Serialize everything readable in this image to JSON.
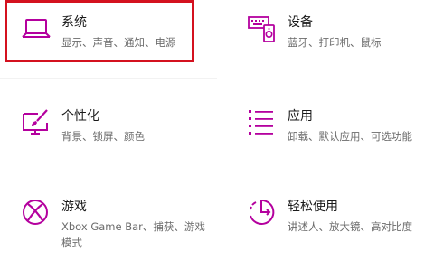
{
  "accent_color": "#b4009e",
  "focus_color": "#d4111f",
  "tiles": [
    {
      "title": "系统",
      "desc": "显示、声音、通知、电源",
      "icon": "laptop-icon"
    },
    {
      "title": "设备",
      "desc": "蓝牙、打印机、鼠标",
      "icon": "keyboard-device-icon"
    },
    {
      "title": "个性化",
      "desc": "背景、锁屏、颜色",
      "icon": "personalization-paint-icon"
    },
    {
      "title": "应用",
      "desc": "卸载、默认应用、可选功能",
      "icon": "apps-list-icon"
    },
    {
      "title": "游戏",
      "desc": "Xbox Game Bar、捕获、游戏模式",
      "icon": "xbox-icon"
    },
    {
      "title": "轻松使用",
      "desc": "讲述人、放大镜、高对比度",
      "icon": "ease-of-access-icon"
    }
  ]
}
